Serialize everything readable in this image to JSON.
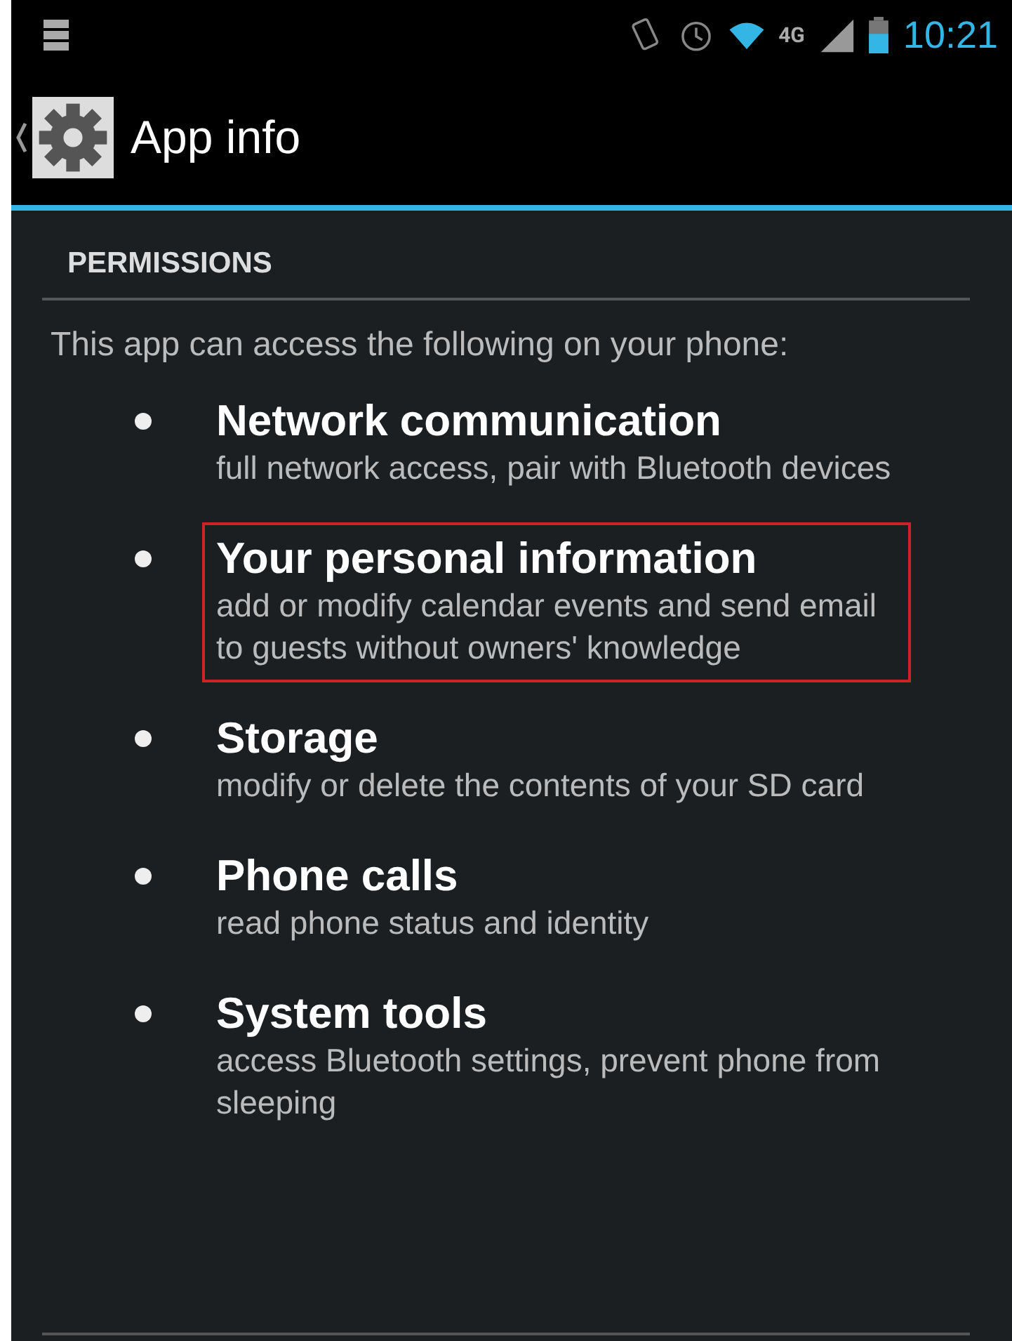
{
  "status_bar": {
    "network": "4G",
    "time": "10:21"
  },
  "action_bar": {
    "title": "App info"
  },
  "section": {
    "header": "PERMISSIONS",
    "intro": "This app can access the following on your phone:"
  },
  "permissions": [
    {
      "title": "Network communication",
      "description": "full network access, pair with Bluetooth devices",
      "highlighted": false
    },
    {
      "title": "Your personal information",
      "description": "add or modify calendar events and send email to guests without owners' knowledge",
      "highlighted": true
    },
    {
      "title": "Storage",
      "description": "modify or delete the contents of your SD card",
      "highlighted": false
    },
    {
      "title": "Phone calls",
      "description": "read phone status and identity",
      "highlighted": false
    },
    {
      "title": "System tools",
      "description": "access Bluetooth settings, prevent phone from sleeping",
      "highlighted": false
    }
  ]
}
